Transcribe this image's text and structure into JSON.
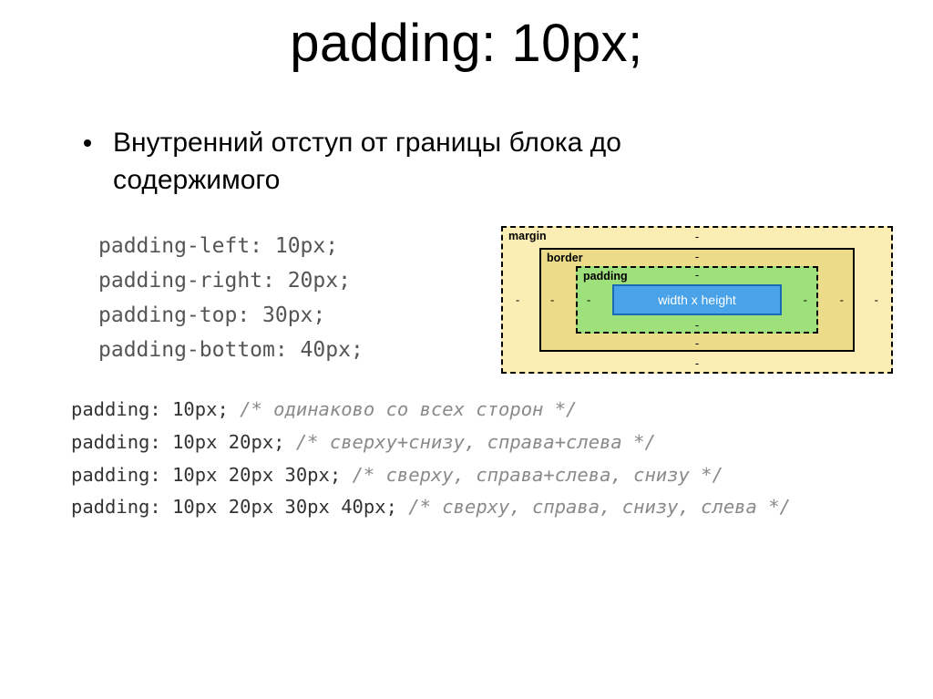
{
  "title": "padding: 10px;",
  "bullet": "Внутренний отступ от границы блока до содержимого",
  "code1": [
    "padding-left: 10px;",
    "padding-right: 20px;",
    "padding-top: 30px;",
    "padding-bottom: 40px;"
  ],
  "code2": [
    {
      "prop": "padding: 10px;",
      "comment": "/* одинаково со всех сторон */"
    },
    {
      "prop": "padding: 10px 20px;",
      "comment": "/* сверху+снизу, справа+слева */"
    },
    {
      "prop": "padding: 10px 20px 30px;",
      "comment": "/* сверху, справа+слева, снизу */"
    },
    {
      "prop": "padding: 10px 20px 30px 40px;",
      "comment": "/* сверху, справа, снизу, слева */"
    }
  ],
  "boxmodel": {
    "margin_label": "margin",
    "border_label": "border",
    "padding_label": "padding",
    "content_label": "width x height",
    "dash": "-"
  }
}
